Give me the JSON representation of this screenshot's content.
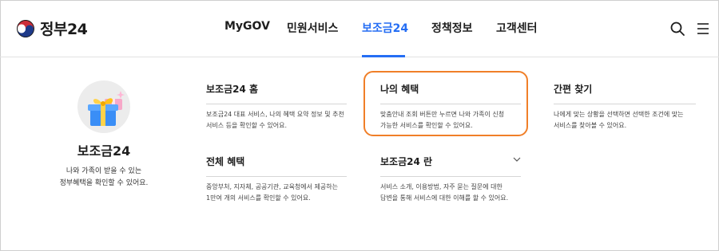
{
  "logo": {
    "text": "정부24",
    "icon": "government-emblem-icon"
  },
  "nav": {
    "items": [
      {
        "label": "MyGOV",
        "active": false
      },
      {
        "label": "민원서비스",
        "active": false
      },
      {
        "label": "보조금24",
        "active": true
      },
      {
        "label": "정책정보",
        "active": false
      },
      {
        "label": "고객센터",
        "active": false
      }
    ],
    "search_icon": "search-icon",
    "menu_icon": "hamburger-menu-icon",
    "accent": "#256ef4"
  },
  "promo": {
    "title": "보조금24",
    "desc_line1": "나와 가족이 받을 수 있는",
    "desc_line2": "정부혜택을 확인할 수 있어요.",
    "icon": "gift-box-icon"
  },
  "cards": [
    {
      "title": "보조금24 홈",
      "desc_line1": "보조금24 대표 서비스, 나의 혜택 요약 정보 및 추천",
      "desc_line2": "서비스 등을 확인할 수 있어요."
    },
    {
      "title": "나의 혜택",
      "desc_line1": "맞춤안내 조회 버튼만 누르면 나와 가족이 신청",
      "desc_line2": "가능한 서비스를 확인할 수 있어요.",
      "highlighted": true
    },
    {
      "title": "간편 찾기",
      "desc_line1": "나에게 맞는 상황을 선택하면 선택한 조건에 맞는",
      "desc_line2": "서비스를 찾아볼 수 있어요."
    },
    {
      "title": "전체 혜택",
      "desc_line1": "중앙부처, 지자체, 공공기관, 교육청에서 제공하는",
      "desc_line2": "1만여 개의 서비스를 확인할 수 있어요."
    },
    {
      "title": "보조금24 란",
      "desc_line1": "서비스 소개, 이용방법, 자주 묻는 질문에 대한",
      "desc_line2": "답변을 통해 서비스에 대한 이해를 할 수 있어요.",
      "expandable": true
    }
  ],
  "highlight_color": "#f07f28"
}
